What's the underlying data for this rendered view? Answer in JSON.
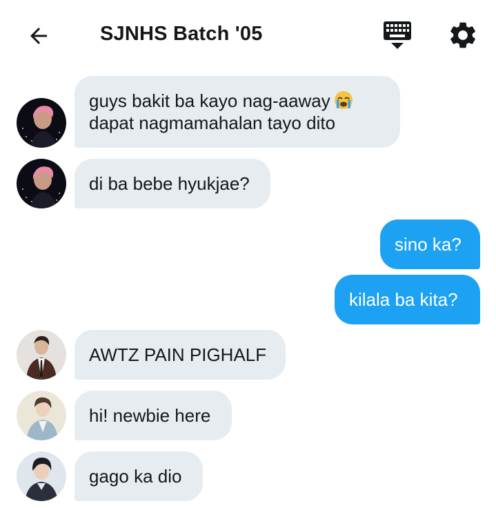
{
  "header": {
    "title": "SJNHS Batch '05",
    "back_icon": "arrow-left-icon",
    "keyboard_icon": "keyboard-hide-icon",
    "settings_icon": "gear-icon"
  },
  "colors": {
    "incoming_bubble": "#e6ecf0",
    "outgoing_bubble": "#1da1f2",
    "text": "#14171a"
  },
  "messages": [
    {
      "direction": "incoming",
      "avatar": "avatar-pink-hair",
      "lines": [
        "guys bakit ba kayo nag-aaway",
        "dapat nagmamahalan tayo dito"
      ],
      "emoji": "crying-face-emoji"
    },
    {
      "direction": "incoming",
      "avatar": "avatar-pink-hair",
      "lines": [
        "di ba bebe hyukjae?"
      ]
    },
    {
      "direction": "outgoing",
      "lines": [
        "sino ka?"
      ]
    },
    {
      "direction": "outgoing",
      "lines": [
        "kilala ba kita?"
      ]
    },
    {
      "direction": "incoming",
      "avatar": "avatar-suit",
      "lines": [
        "AWTZ PAIN PIGHALF"
      ]
    },
    {
      "direction": "incoming",
      "avatar": "avatar-light-jacket",
      "lines": [
        "hi! newbie here"
      ]
    },
    {
      "direction": "incoming",
      "avatar": "avatar-dark-hair",
      "lines": [
        "gago ka dio"
      ]
    }
  ]
}
